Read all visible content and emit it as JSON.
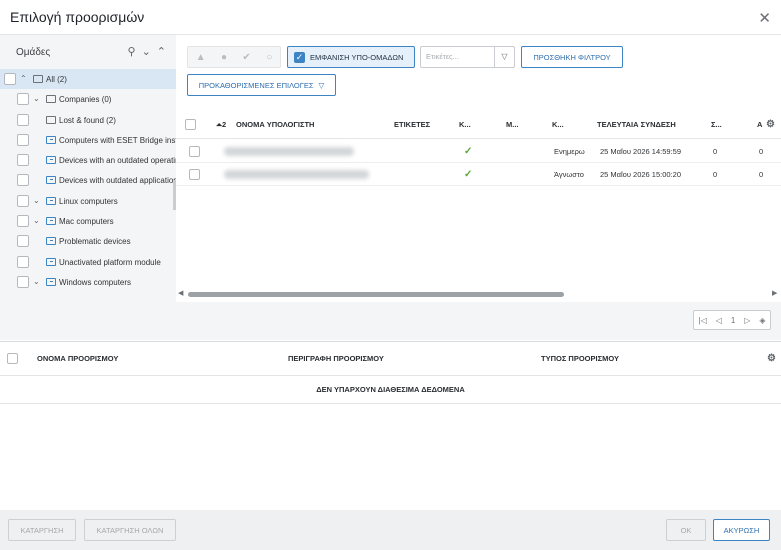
{
  "dialog": {
    "title": "Επιλογή προορισμών"
  },
  "groups": {
    "header": "Ομάδες",
    "tree": [
      {
        "label": "All (2)",
        "level": 0,
        "chevron": "^",
        "icon": "folder-icon",
        "selected": true
      },
      {
        "label": "Companies (0)",
        "level": 1,
        "chevron": "v",
        "icon": "companies-icon"
      },
      {
        "label": "Lost & found (2)",
        "level": 1,
        "chevron": "",
        "icon": "folder-icon"
      },
      {
        "label": "Computers with ESET Bridge installed",
        "level": 1,
        "chevron": "",
        "icon": "dynamic-group-icon"
      },
      {
        "label": "Devices with an outdated operating system",
        "level": 1,
        "chevron": "",
        "icon": "dynamic-group-icon"
      },
      {
        "label": "Devices with outdated applications",
        "level": 1,
        "chevron": "",
        "icon": "dynamic-group-icon"
      },
      {
        "label": "Linux computers",
        "level": 1,
        "chevron": "v",
        "icon": "dynamic-group-icon"
      },
      {
        "label": "Mac computers",
        "level": 1,
        "chevron": "v",
        "icon": "dynamic-group-icon"
      },
      {
        "label": "Problematic devices",
        "level": 1,
        "chevron": "",
        "icon": "dynamic-group-icon"
      },
      {
        "label": "Unactivated platform module",
        "level": 1,
        "chevron": "",
        "icon": "dynamic-group-icon"
      },
      {
        "label": "Windows computers",
        "level": 1,
        "chevron": "v",
        "icon": "dynamic-group-icon"
      }
    ]
  },
  "toolbar": {
    "status_icons": [
      "warning-icon",
      "error-icon",
      "ok-icon",
      "unknown-icon"
    ],
    "show_subgroups": "ΕΜΦΑΝΙΣΗ ΥΠΟ-ΟΜΑΔΩΝ",
    "tags_placeholder": "Ετικέτες...",
    "add_filter": "ΠΡΟΣΘΗΚΗ ΦΙΛΤΡΟΥ",
    "presets": "ΠΡΟΚΑΘΟΡΙΣΜΕΝΕΣ ΕΠΙΛΟΓΕΣ"
  },
  "computers": {
    "columns": [
      "⏶2",
      "ΟΝΟΜΑ ΥΠΟΛΟΓΙΣΤΗ",
      "ΕΤΙΚΕΤΕΣ",
      "Κ...",
      "Μ...",
      "Κ...",
      "ΤΕΛΕΥΤΑΙΑ ΣΥΝΔΕΣΗ",
      "Σ...",
      "Α"
    ],
    "rows": [
      {
        "status": "ok",
        "module": "Ενημερω",
        "last_connection": "25 Μαΐου 2026 14:59:59",
        "col_s": "0",
        "col_a": "0"
      },
      {
        "status": "ok",
        "module": "Άγνωστο",
        "last_connection": "25 Μαΐου 2026 15:00:20",
        "col_s": "0",
        "col_a": "0"
      }
    ],
    "page": "1"
  },
  "destinations": {
    "columns": [
      "ΟΝΟΜΑ ΠΡΟΟΡΙΣΜΟΥ",
      "ΠΕΡΙΓΡΑΦΗ ΠΡΟΟΡΙΣΜΟΥ",
      "ΤΥΠΟΣ ΠΡΟΟΡΙΣΜΟΥ"
    ],
    "empty_text": "ΔΕΝ ΥΠΑΡΧΟΥΝ ΔΙΑΘΕΣΙΜΑ ΔΕΔΟΜΕΝΑ"
  },
  "footer": {
    "remove": "ΚΑΤΑΡΓΗΣΗ",
    "remove_all": "ΚΑΤΑΡΓΗΣΗ ΟΛΩΝ",
    "ok": "OK",
    "cancel": "ΑΚΥΡΩΣΗ"
  },
  "colors": {
    "accent": "#3d84c4",
    "selected_row": "#d9e7f5",
    "ok_green": "#5ea53a"
  }
}
